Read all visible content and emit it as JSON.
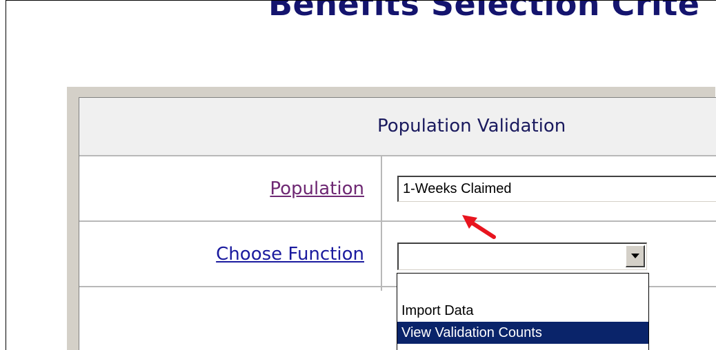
{
  "page": {
    "heading": "Benefits Selection Crite"
  },
  "panel": {
    "title": "Population Validation",
    "population": {
      "label": "Population",
      "value": "1-Weeks Claimed"
    },
    "function": {
      "label": "Choose Function",
      "selected_value": "",
      "options": [
        "",
        "Import Data",
        "View Validation Counts"
      ],
      "highlighted_option": "View Validation Counts"
    }
  },
  "annotation": {
    "arrow_color": "#e8141e"
  },
  "colors": {
    "heading": "#14146e",
    "panel_border": "#d4d0c8",
    "visited_link": "#6e2873",
    "link": "#1a1a9e",
    "selection_highlight": "#0a246a"
  }
}
